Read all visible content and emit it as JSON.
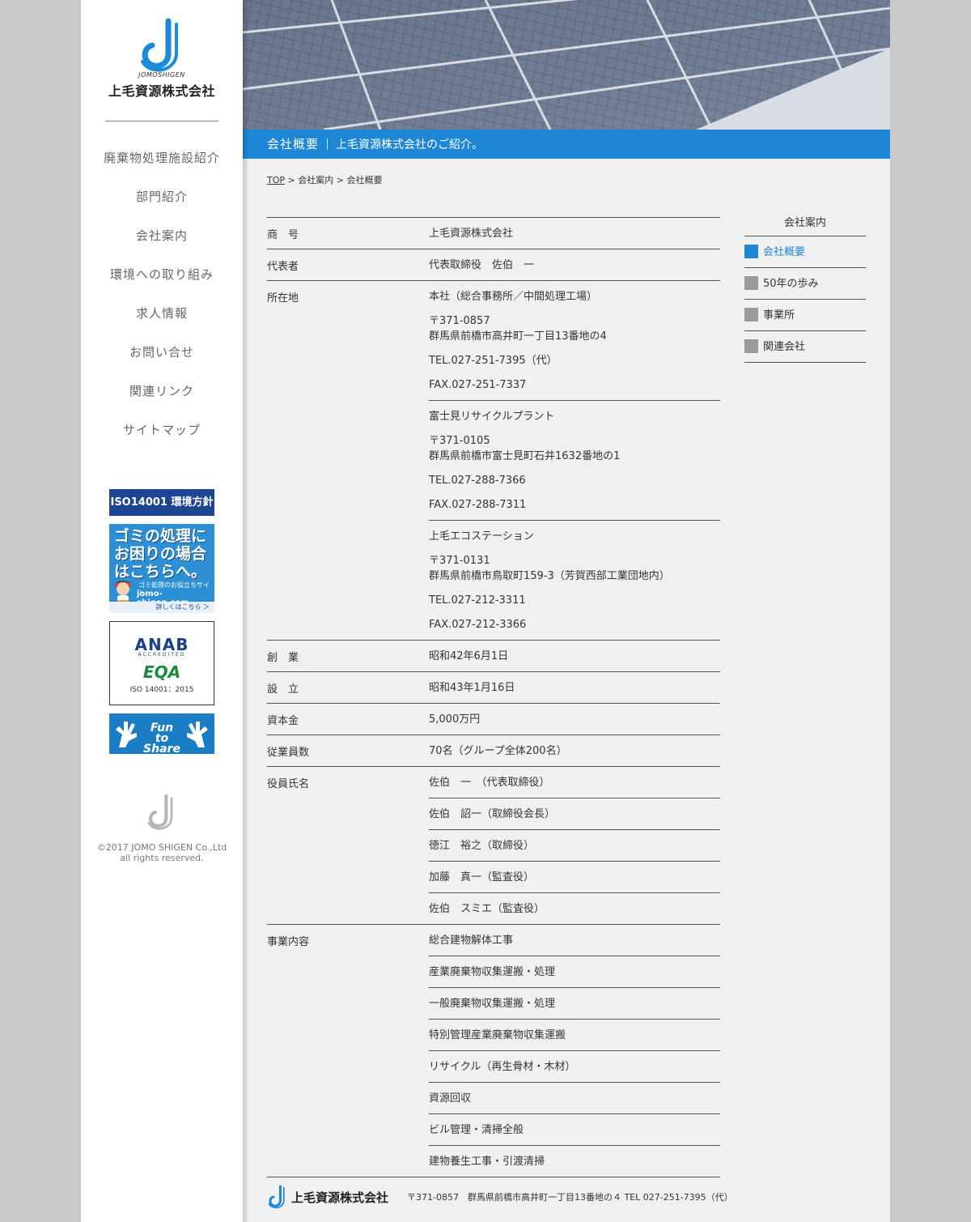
{
  "brand": {
    "name": "上毛資源株式会社",
    "sub": "JOMOSHIGEN",
    "accent": "#1d87d5",
    "logo_blue": "#1c8ad8"
  },
  "nav": [
    {
      "label": "廃棄物処理施設紹介"
    },
    {
      "label": "部門紹介"
    },
    {
      "label": "会社案内"
    },
    {
      "label": "環境への取り組み"
    },
    {
      "label": "求人情報"
    },
    {
      "label": "お問い合せ"
    },
    {
      "label": "関連リンク"
    },
    {
      "label": "サイトマップ"
    }
  ],
  "banners": {
    "iso": "ISO14001 環境方針",
    "gomi_big": [
      "ゴミの処理に",
      "お困りの場合",
      "はこちらへ。"
    ],
    "gomi_small": "ゴミ処理のお役立ちサイト",
    "gomi_url": "jomo-shigen.com",
    "gomi_more": "詳しくはこちら ＞",
    "anab": "ANAB",
    "anab_sub": "ACCREDITED",
    "eqa": "EQA",
    "iso_std": "ISO 14001：2015",
    "fun": [
      "Fun",
      "to",
      "Share"
    ]
  },
  "copyright": [
    "©2017 JOMO SHIGEN Co.,Ltd",
    "all rights reserved."
  ],
  "page": {
    "title": "会社概要",
    "subtitle": "上毛資源株式会社のご紹介。"
  },
  "breadcrumb": {
    "top": "TOP",
    "sep": " > ",
    "mid": "会社案内",
    "current": "会社概要"
  },
  "info": {
    "trade_name_k": "商　号",
    "trade_name_v": "上毛資源株式会社",
    "rep_k": "代表者",
    "rep_v": "代表取締役　佐伯　一",
    "loc_k": "所在地",
    "locations": [
      {
        "name": "本社（総合事務所／中間処理工場）",
        "zip": "〒371-0857",
        "addr": "群馬県前橋市高井町一丁目13番地の4",
        "tel": "TEL.027-251-7395（代）",
        "fax": "FAX.027-251-7337"
      },
      {
        "name": "富士見リサイクルプラント",
        "zip": "〒371-0105",
        "addr": "群馬県前橋市富士見町石井1632番地の1",
        "tel": "TEL.027-288-7366",
        "fax": "FAX.027-288-7311"
      },
      {
        "name": "上毛エコステーション",
        "zip": "〒371-0131",
        "addr": "群馬県前橋市鳥取町159-3（芳賀西部工業団地内）",
        "tel": "TEL.027-212-3311",
        "fax": "FAX.027-212-3366"
      }
    ],
    "founded_k": "創　業",
    "founded_v": "昭和42年6月1日",
    "est_k": "設　立",
    "est_v": "昭和43年1月16日",
    "capital_k": "資本金",
    "capital_v": "5,000万円",
    "staff_k": "従業員数",
    "staff_v": "70名（グループ全体200名）",
    "officers_k": "役員氏名",
    "officers": [
      "佐伯　一　（代表取締役）",
      "佐伯　詔一（取締役会長）",
      "徳江　裕之（取締役）",
      "加藤　真一（監査役）",
      "佐伯　スミエ（監査役）"
    ],
    "biz_k": "事業内容",
    "business": [
      "総合建物解体工事",
      "産業廃棄物収集運搬・処理",
      "一般廃棄物収集運搬・処理",
      "特別管理産業廃棄物収集運搬",
      "リサイクル（再生骨材・木材）",
      "資源回収",
      "ビル管理・清掃全般",
      "建物養生工事・引渡清掃"
    ]
  },
  "subnav": {
    "heading": "会社案内",
    "items": [
      {
        "label": "会社概要"
      },
      {
        "label": "50年の歩み"
      },
      {
        "label": "事業所"
      },
      {
        "label": "関連会社"
      }
    ]
  },
  "footer": {
    "name": "上毛資源株式会社",
    "address": "〒371-0857　群馬県前橋市高井町一丁目13番地の４ TEL 027-251-7395（代）"
  }
}
